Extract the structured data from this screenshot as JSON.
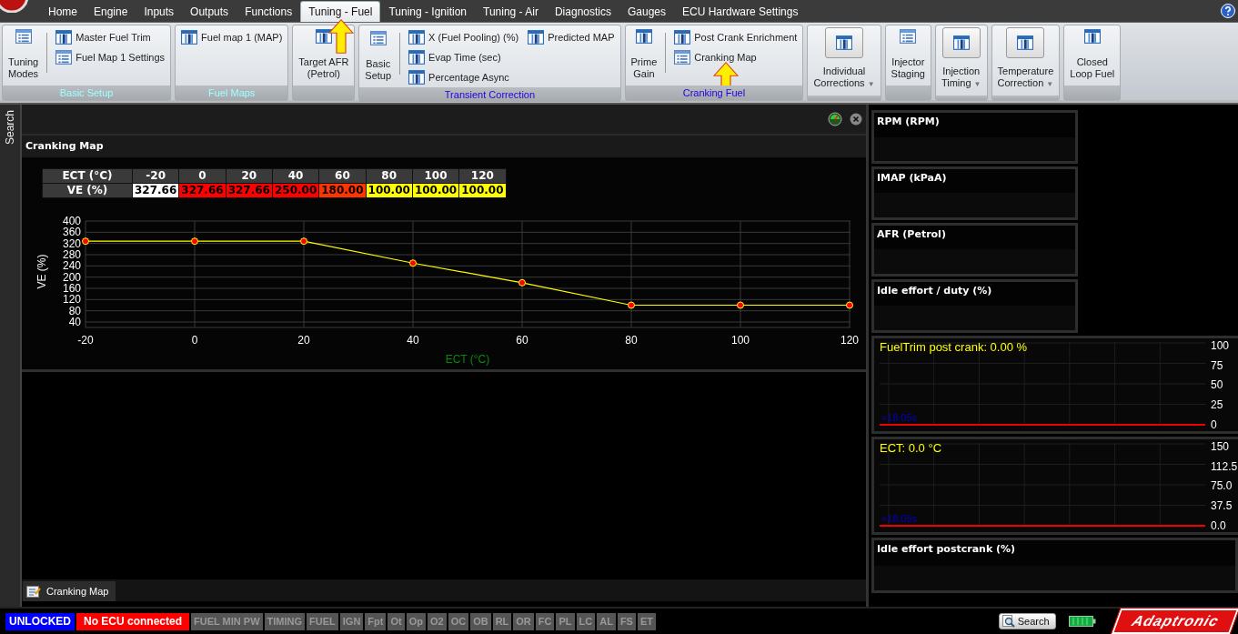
{
  "menu_tabs": [
    {
      "label": "Home",
      "selected": false
    },
    {
      "label": "Engine",
      "selected": false
    },
    {
      "label": "Inputs",
      "selected": false
    },
    {
      "label": "Outputs",
      "selected": false
    },
    {
      "label": "Functions",
      "selected": false
    },
    {
      "label": "Tuning - Fuel",
      "selected": true
    },
    {
      "label": "Tuning - Ignition",
      "selected": false
    },
    {
      "label": "Tuning - Air",
      "selected": false
    },
    {
      "label": "Diagnostics",
      "selected": false
    },
    {
      "label": "Gauges",
      "selected": false
    },
    {
      "label": "ECU Hardware Settings",
      "selected": false
    }
  ],
  "ribbon": {
    "groups": [
      {
        "label": "Basic Setup",
        "active": false,
        "large": [
          {
            "kind": "list",
            "label": "Tuning\nModes"
          }
        ],
        "columns": [
          [
            {
              "kind": "table",
              "label": "Master Fuel Trim"
            },
            {
              "kind": "list",
              "label": "Fuel Map 1 Settings"
            }
          ]
        ]
      },
      {
        "label": "Fuel Maps",
        "active": false,
        "columns": [
          [
            {
              "kind": "table",
              "label": "Fuel map 1 (MAP)"
            }
          ]
        ]
      },
      {
        "large": [
          {
            "kind": "table",
            "label": "Target AFR\n(Petrol)"
          }
        ]
      },
      {
        "label": "Transient Correction",
        "active": true,
        "large": [
          {
            "kind": "list",
            "label": "Basic\nSetup"
          }
        ],
        "columns": [
          [
            {
              "kind": "table",
              "label": "X (Fuel Pooling) (%)"
            },
            {
              "kind": "table",
              "label": "Evap Time (sec)"
            },
            {
              "kind": "table",
              "label": "Percentage Async"
            }
          ],
          [
            {
              "kind": "table",
              "label": "Predicted MAP"
            }
          ]
        ]
      },
      {
        "label": "Cranking Fuel",
        "active": true,
        "large": [
          {
            "kind": "table",
            "label": "Prime\nGain"
          }
        ],
        "columns": [
          [
            {
              "kind": "table",
              "label": "Post Crank Enrichment"
            },
            {
              "kind": "list",
              "label": "Cranking Map"
            }
          ]
        ]
      },
      {
        "large": [
          {
            "kind": "table",
            "label": "Individual\nCorrections",
            "caret": "▼"
          }
        ]
      },
      {
        "large": [
          {
            "kind": "list",
            "label": "Injector\nStaging"
          }
        ]
      },
      {
        "large": [
          {
            "kind": "table",
            "label": "Injection\nTiming",
            "caret": "▼"
          }
        ]
      },
      {
        "large": [
          {
            "kind": "table",
            "label": "Temperature\nCorrection",
            "caret": "▼"
          }
        ]
      },
      {
        "large": [
          {
            "kind": "table",
            "label": "Closed\nLoop Fuel"
          }
        ]
      }
    ]
  },
  "side_tab": "Search",
  "document": {
    "title": "Cranking Map",
    "table": {
      "header": [
        "ECT (°C)",
        "-20",
        "0",
        "20",
        "40",
        "60",
        "80",
        "100",
        "120"
      ],
      "row_label": "VE (%)",
      "cells": [
        {
          "value": "327.66",
          "color": "#ffffff"
        },
        {
          "value": "327.66",
          "color": "#ff0000"
        },
        {
          "value": "327.66",
          "color": "#ff0000"
        },
        {
          "value": "250.00",
          "color": "#ff0000"
        },
        {
          "value": "180.00",
          "color": "#ff3300"
        },
        {
          "value": "100.00",
          "color": "#ffff00"
        },
        {
          "value": "100.00",
          "color": "#ffff00"
        },
        {
          "value": "100.00",
          "color": "#ffff00"
        }
      ]
    },
    "chart_data": {
      "type": "line",
      "xlabel": "ECT (°C)",
      "ylabel": "VE (%)",
      "x": [
        -20,
        0,
        20,
        40,
        60,
        80,
        100,
        120
      ],
      "series": [
        {
          "color": "#ffff00",
          "marker": "circle",
          "values": [
            328,
            328,
            328,
            250,
            180,
            100,
            100,
            100
          ]
        }
      ],
      "xlim": [
        -20,
        120
      ],
      "ylim": [
        40,
        400
      ],
      "xticks": [
        -20,
        0,
        20,
        40,
        60,
        80,
        100,
        120
      ],
      "yticks": [
        40,
        80,
        120,
        160,
        200,
        240,
        280,
        320,
        360,
        400
      ],
      "grid": true
    },
    "bottom_tab": "Cranking Map"
  },
  "gauges": [
    {
      "kind": "tile",
      "label": "RPM (RPM)",
      "wide": false
    },
    {
      "kind": "tile",
      "label": "IMAP  (kPaA)",
      "wide": false
    },
    {
      "kind": "tile",
      "label": "AFR (Petrol)",
      "wide": false
    },
    {
      "kind": "tile",
      "label": "Idle effort / duty (%)",
      "wide": false
    },
    {
      "kind": "graph",
      "title": "FuelTrim post crank:  0.00 %",
      "time": "≈18.05s",
      "scale": [
        "100",
        "75",
        "50",
        "25",
        "0"
      ]
    },
    {
      "kind": "graph",
      "title": "ECT:  0.0 °C",
      "time": "≈18.05s",
      "scale": [
        "150",
        "112.5",
        "75.0",
        "37.5",
        "0.0"
      ]
    },
    {
      "kind": "tile",
      "label": "Idle effort postcrank (%)",
      "wide": true
    }
  ],
  "status": {
    "lock": "UNLOCKED",
    "connection": "No ECU connected",
    "indicators": [
      {
        "label": "FUEL MIN PW",
        "on": false
      },
      {
        "label": "TIMING",
        "on": false
      },
      {
        "label": "FUEL",
        "on": false
      },
      {
        "label": "IGN",
        "on": false
      },
      {
        "label": "Fpt",
        "on": false
      },
      {
        "label": "Ot",
        "on": false
      },
      {
        "label": "Op",
        "on": false
      },
      {
        "label": "O2",
        "on": false
      },
      {
        "label": "OC",
        "on": false
      },
      {
        "label": "OB",
        "on": false
      },
      {
        "label": "RL",
        "on": false
      },
      {
        "label": "OR",
        "on": false
      },
      {
        "label": "FC",
        "on": false
      },
      {
        "label": "PL",
        "on": false
      },
      {
        "label": "LC",
        "on": false
      },
      {
        "label": "AL",
        "on": false
      },
      {
        "label": "FS",
        "on": false
      },
      {
        "label": "ET",
        "on": false
      }
    ],
    "search_button": "Search",
    "logo": "Adaptronic"
  }
}
